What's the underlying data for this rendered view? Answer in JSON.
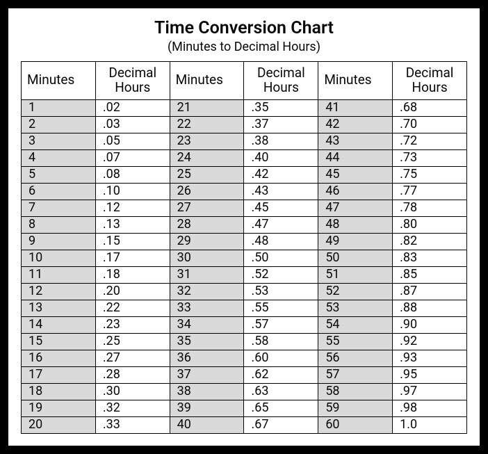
{
  "title": "Time Conversion Chart",
  "subtitle": "(Minutes to Decimal Hours)",
  "headers": {
    "minutes": "Minutes",
    "decimal": "Decimal Hours"
  },
  "chart_data": {
    "type": "table",
    "title": "Time Conversion Chart (Minutes to Decimal Hours)",
    "columns": [
      "Minutes",
      "Decimal Hours"
    ],
    "rows": [
      {
        "minutes": "1",
        "decimal": ".02"
      },
      {
        "minutes": "2",
        "decimal": ".03"
      },
      {
        "minutes": "3",
        "decimal": ".05"
      },
      {
        "minutes": "4",
        "decimal": ".07"
      },
      {
        "minutes": "5",
        "decimal": ".08"
      },
      {
        "minutes": "6",
        "decimal": ".10"
      },
      {
        "minutes": "7",
        "decimal": ".12"
      },
      {
        "minutes": "8",
        "decimal": ".13"
      },
      {
        "minutes": "9",
        "decimal": ".15"
      },
      {
        "minutes": "10",
        "decimal": ".17"
      },
      {
        "minutes": "11",
        "decimal": ".18"
      },
      {
        "minutes": "12",
        "decimal": ".20"
      },
      {
        "minutes": "13",
        "decimal": ".22"
      },
      {
        "minutes": "14",
        "decimal": ".23"
      },
      {
        "minutes": "15",
        "decimal": ".25"
      },
      {
        "minutes": "16",
        "decimal": ".27"
      },
      {
        "minutes": "17",
        "decimal": ".28"
      },
      {
        "minutes": "18",
        "decimal": ".30"
      },
      {
        "minutes": "19",
        "decimal": ".32"
      },
      {
        "minutes": "20",
        "decimal": ".33"
      },
      {
        "minutes": "21",
        "decimal": ".35"
      },
      {
        "minutes": "22",
        "decimal": ".37"
      },
      {
        "minutes": "23",
        "decimal": ".38"
      },
      {
        "minutes": "24",
        "decimal": ".40"
      },
      {
        "minutes": "25",
        "decimal": ".42"
      },
      {
        "minutes": "26",
        "decimal": ".43"
      },
      {
        "minutes": "27",
        "decimal": ".45"
      },
      {
        "minutes": "28",
        "decimal": ".47"
      },
      {
        "minutes": "29",
        "decimal": ".48"
      },
      {
        "minutes": "30",
        "decimal": ".50"
      },
      {
        "minutes": "31",
        "decimal": ".52"
      },
      {
        "minutes": "32",
        "decimal": ".53"
      },
      {
        "minutes": "33",
        "decimal": ".55"
      },
      {
        "minutes": "34",
        "decimal": ".57"
      },
      {
        "minutes": "35",
        "decimal": ".58"
      },
      {
        "minutes": "36",
        "decimal": ".60"
      },
      {
        "minutes": "37",
        "decimal": ".62"
      },
      {
        "minutes": "38",
        "decimal": ".63"
      },
      {
        "minutes": "39",
        "decimal": ".65"
      },
      {
        "minutes": "40",
        "decimal": ".67"
      },
      {
        "minutes": "41",
        "decimal": ".68"
      },
      {
        "minutes": "42",
        "decimal": ".70"
      },
      {
        "minutes": "43",
        "decimal": ".72"
      },
      {
        "minutes": "44",
        "decimal": ".73"
      },
      {
        "minutes": "45",
        "decimal": ".75"
      },
      {
        "minutes": "46",
        "decimal": ".77"
      },
      {
        "minutes": "47",
        "decimal": ".78"
      },
      {
        "minutes": "48",
        "decimal": ".80"
      },
      {
        "minutes": "49",
        "decimal": ".82"
      },
      {
        "minutes": "50",
        "decimal": ".83"
      },
      {
        "minutes": "51",
        "decimal": ".85"
      },
      {
        "minutes": "52",
        "decimal": ".87"
      },
      {
        "minutes": "53",
        "decimal": ".88"
      },
      {
        "minutes": "54",
        "decimal": ".90"
      },
      {
        "minutes": "55",
        "decimal": ".92"
      },
      {
        "minutes": "56",
        "decimal": ".93"
      },
      {
        "minutes": "57",
        "decimal": ".95"
      },
      {
        "minutes": "58",
        "decimal": ".97"
      },
      {
        "minutes": "59",
        "decimal": ".98"
      },
      {
        "minutes": "60",
        "decimal": "1.0"
      }
    ]
  }
}
